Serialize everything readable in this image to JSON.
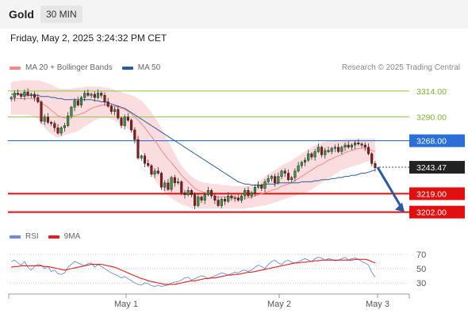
{
  "header": {
    "title": "Gold",
    "interval": "30 MIN"
  },
  "timestamp": "Friday, May 2, 2025 3:24:32 PM CET",
  "credit": "Research © 2025 Trading Central",
  "legend_main": [
    {
      "label": "MA 20 + Bollinger Bands",
      "color": "#f08a86"
    },
    {
      "label": "MA 50",
      "color": "#2f5d9a"
    }
  ],
  "legend_rsi": [
    {
      "label": "RSI",
      "color": "#6a8fd6"
    },
    {
      "label": "9MA",
      "color": "#e02020"
    }
  ],
  "chart_data": [
    {
      "type": "candlestick",
      "ylim": [
        3190,
        3330
      ],
      "x_ticks": [
        "May 1",
        "May 2",
        "May 3"
      ],
      "levels": [
        {
          "value": 3314.0,
          "label": "3314.00",
          "color": "#8cc63f",
          "style": "thin"
        },
        {
          "value": 3290.0,
          "label": "3290.00",
          "color": "#8cc63f",
          "style": "thin"
        },
        {
          "value": 3268.0,
          "label": "3268.00",
          "color": "#2b6fd6",
          "style": "blue"
        },
        {
          "value": 3243.47,
          "label": "3243.47",
          "color": "#222222",
          "style": "price"
        },
        {
          "value": 3219.0,
          "label": "3219.00",
          "color": "#e01010",
          "style": "red"
        },
        {
          "value": 3202.0,
          "label": "3202.00",
          "color": "#e01010",
          "style": "red"
        }
      ],
      "close": [
        3308,
        3312,
        3311,
        3309,
        3313,
        3310,
        3311,
        3308,
        3304,
        3286,
        3290,
        3285,
        3284,
        3280,
        3275,
        3280,
        3282,
        3291,
        3299,
        3305,
        3301,
        3308,
        3312,
        3310,
        3311,
        3308,
        3312,
        3310,
        3304,
        3300,
        3295,
        3297,
        3289,
        3282,
        3290,
        3287,
        3278,
        3269,
        3252,
        3254,
        3247,
        3245,
        3237,
        3240,
        3238,
        3225,
        3229,
        3223,
        3234,
        3229,
        3230,
        3220,
        3218,
        3222,
        3218,
        3208,
        3216,
        3213,
        3218,
        3222,
        3217,
        3213,
        3208,
        3214,
        3212,
        3217,
        3215,
        3215,
        3213,
        3217,
        3222,
        3217,
        3220,
        3225,
        3227,
        3224,
        3230,
        3233,
        3235,
        3229,
        3235,
        3240,
        3238,
        3232,
        3234,
        3240,
        3245,
        3248,
        3250,
        3256,
        3253,
        3258,
        3262,
        3255,
        3259,
        3258,
        3261,
        3262,
        3258,
        3262,
        3264,
        3262,
        3264,
        3266,
        3265,
        3264,
        3262,
        3256,
        3247,
        3243
      ],
      "ma20": [
        3306,
        3307,
        3307,
        3307,
        3307,
        3307,
        3307,
        3307,
        3306,
        3303,
        3301,
        3299,
        3296,
        3294,
        3291,
        3290,
        3289,
        3289,
        3290,
        3291,
        3292,
        3293,
        3294,
        3296,
        3298,
        3299,
        3300,
        3301,
        3301,
        3301,
        3300,
        3300,
        3299,
        3298,
        3297,
        3295,
        3293,
        3290,
        3287,
        3284,
        3280,
        3276,
        3272,
        3268,
        3264,
        3259,
        3255,
        3251,
        3248,
        3244,
        3240,
        3236,
        3233,
        3230,
        3227,
        3224,
        3222,
        3221,
        3220,
        3219,
        3218,
        3217,
        3216,
        3216,
        3216,
        3216,
        3216,
        3216,
        3215,
        3215,
        3215,
        3215,
        3216,
        3217,
        3218,
        3219,
        3220,
        3221,
        3222,
        3223,
        3224,
        3226,
        3227,
        3228,
        3229,
        3231,
        3233,
        3235,
        3237,
        3239,
        3241,
        3243,
        3245,
        3246,
        3248,
        3250,
        3251,
        3253,
        3254,
        3255,
        3257,
        3258,
        3259,
        3260,
        3261,
        3261,
        3261,
        3260,
        3259,
        3258
      ],
      "bb_upper": [
        3322,
        3323,
        3323,
        3324,
        3324,
        3324,
        3324,
        3324,
        3324,
        3323,
        3322,
        3321,
        3320,
        3318,
        3317,
        3316,
        3316,
        3316,
        3316,
        3317,
        3317,
        3317,
        3318,
        3318,
        3318,
        3318,
        3318,
        3318,
        3317,
        3317,
        3316,
        3315,
        3314,
        3313,
        3312,
        3311,
        3310,
        3309,
        3307,
        3305,
        3302,
        3298,
        3294,
        3290,
        3285,
        3280,
        3274,
        3268,
        3262,
        3256,
        3250,
        3245,
        3241,
        3238,
        3235,
        3233,
        3231,
        3230,
        3229,
        3229,
        3228,
        3228,
        3228,
        3227,
        3227,
        3227,
        3226,
        3226,
        3226,
        3226,
        3226,
        3226,
        3227,
        3228,
        3230,
        3232,
        3235,
        3237,
        3239,
        3241,
        3243,
        3245,
        3247,
        3248,
        3250,
        3252,
        3254,
        3256,
        3258,
        3260,
        3262,
        3264,
        3265,
        3266,
        3267,
        3268,
        3268,
        3269,
        3269,
        3269,
        3270,
        3270,
        3270,
        3270,
        3270,
        3270,
        3270,
        3270,
        3270,
        3270
      ],
      "bb_lower": [
        3292,
        3292,
        3292,
        3292,
        3292,
        3292,
        3291,
        3290,
        3288,
        3284,
        3280,
        3277,
        3274,
        3272,
        3271,
        3272,
        3273,
        3274,
        3275,
        3276,
        3277,
        3279,
        3281,
        3283,
        3285,
        3287,
        3288,
        3289,
        3289,
        3289,
        3288,
        3287,
        3285,
        3283,
        3281,
        3279,
        3276,
        3271,
        3265,
        3258,
        3251,
        3244,
        3237,
        3232,
        3228,
        3223,
        3220,
        3217,
        3215,
        3213,
        3211,
        3209,
        3208,
        3207,
        3206,
        3205,
        3205,
        3205,
        3205,
        3205,
        3205,
        3205,
        3205,
        3205,
        3205,
        3205,
        3205,
        3205,
        3205,
        3205,
        3205,
        3206,
        3206,
        3207,
        3207,
        3208,
        3208,
        3209,
        3210,
        3211,
        3212,
        3213,
        3214,
        3215,
        3216,
        3217,
        3218,
        3219,
        3220,
        3221,
        3223,
        3225,
        3227,
        3229,
        3231,
        3233,
        3235,
        3237,
        3239,
        3241,
        3242,
        3243,
        3244,
        3245,
        3246,
        3247,
        3248,
        3249,
        3250,
        3251
      ],
      "ma50": [
        3311,
        3311,
        3311,
        3311,
        3311,
        3310,
        3310,
        3310,
        3310,
        3309,
        3309,
        3309,
        3308,
        3308,
        3307,
        3307,
        3306,
        3306,
        3306,
        3306,
        3306,
        3306,
        3306,
        3306,
        3306,
        3305,
        3305,
        3304,
        3304,
        3303,
        3302,
        3301,
        3300,
        3299,
        3298,
        3296,
        3294,
        3292,
        3290,
        3288,
        3286,
        3284,
        3282,
        3280,
        3278,
        3276,
        3274,
        3272,
        3270,
        3268,
        3266,
        3264,
        3262,
        3260,
        3258,
        3256,
        3254,
        3252,
        3250,
        3248,
        3246,
        3244,
        3242,
        3240,
        3238,
        3236,
        3234,
        3232,
        3230,
        3229,
        3228,
        3228,
        3227,
        3227,
        3227,
        3227,
        3228,
        3228,
        3228,
        3228,
        3229,
        3229,
        3229,
        3229,
        3229,
        3229,
        3229,
        3230,
        3230,
        3230,
        3230,
        3231,
        3231,
        3232,
        3232,
        3232,
        3233,
        3233,
        3234,
        3234,
        3235,
        3235,
        3236,
        3236,
        3237,
        3238,
        3238,
        3239,
        3240,
        3241
      ],
      "projection": {
        "from": 3243.47,
        "to": 3202.0
      }
    },
    {
      "type": "line",
      "ylim": [
        20,
        80
      ],
      "y_ticks": [
        30,
        50,
        70
      ],
      "ref_lines": [
        30,
        50,
        70
      ],
      "series": [
        {
          "name": "RSI",
          "color": "#6a8fd6",
          "values": [
            60,
            62,
            58,
            55,
            60,
            52,
            48,
            53,
            56,
            55,
            50,
            53,
            46,
            48,
            43,
            42,
            44,
            52,
            56,
            60,
            58,
            56,
            54,
            57,
            58,
            52,
            56,
            53,
            50,
            47,
            44,
            42,
            40,
            37,
            39,
            36,
            33,
            30,
            28,
            27,
            30,
            29,
            26,
            25,
            27,
            25,
            26,
            27,
            30,
            31,
            32,
            34,
            37,
            38,
            34,
            36,
            38,
            40,
            39,
            36,
            38,
            40,
            42,
            44,
            43,
            41,
            43,
            45,
            44,
            47,
            48,
            46,
            48,
            52,
            55,
            53,
            50,
            56,
            60,
            62,
            58,
            56,
            60,
            62,
            59,
            58,
            60,
            62,
            64,
            62,
            60,
            64,
            66,
            65,
            62,
            64,
            63,
            61,
            62,
            64,
            66,
            62,
            64,
            65,
            63,
            60,
            58,
            55,
            45,
            38
          ]
        },
        {
          "name": "9MA",
          "color": "#e02020",
          "values": [
            52,
            53,
            53,
            54,
            54,
            54,
            54,
            54,
            54,
            54,
            53,
            53,
            52,
            51,
            50,
            49,
            48,
            49,
            50,
            51,
            52,
            53,
            54,
            55,
            56,
            56,
            56,
            56,
            55,
            54,
            53,
            52,
            50,
            48,
            46,
            44,
            42,
            40,
            38,
            36,
            35,
            33,
            32,
            31,
            30,
            29,
            28,
            28,
            28,
            28,
            29,
            30,
            31,
            32,
            33,
            33,
            34,
            35,
            36,
            36,
            37,
            37,
            38,
            39,
            40,
            41,
            41,
            42,
            42,
            43,
            44,
            45,
            45,
            46,
            47,
            48,
            49,
            50,
            51,
            52,
            53,
            54,
            55,
            56,
            57,
            58,
            58,
            59,
            59,
            60,
            60,
            61,
            61,
            62,
            62,
            62,
            62,
            62,
            62,
            62,
            62,
            62,
            62,
            63,
            63,
            63,
            63,
            62,
            60,
            58
          ]
        }
      ]
    }
  ]
}
